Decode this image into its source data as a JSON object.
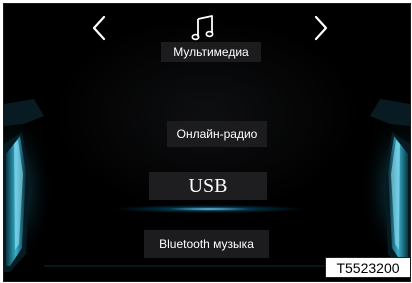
{
  "header": {
    "title": "Мультимедиа",
    "icon": "music-note-icon",
    "prev_icon": "chevron-left-icon",
    "next_icon": "chevron-right-icon"
  },
  "menu": {
    "items": [
      {
        "label": "Онлайн-радио"
      },
      {
        "label": "USB",
        "selected": true
      },
      {
        "label": "Bluetooth музыка"
      }
    ]
  },
  "figure_code": "T5523200",
  "colors": {
    "background": "#000000",
    "label_bg": "#1c1c1e",
    "text": "#ffffff",
    "accent_glow": "#3fc8e8"
  }
}
